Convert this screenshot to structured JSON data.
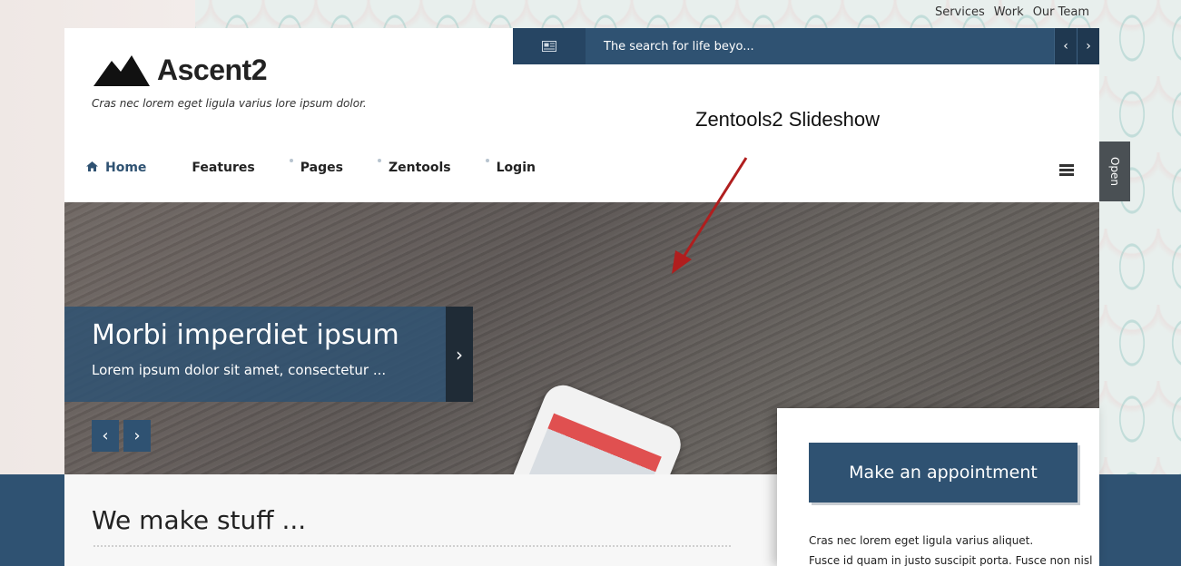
{
  "top_links": [
    "Services",
    "Work",
    "Our Team"
  ],
  "header": {
    "logo_text": "Ascent2",
    "tagline": "Cras nec lorem eget ligula varius lore ipsum dolor."
  },
  "ticker": {
    "icon": "newspaper-icon",
    "text": "The search for life beyo...",
    "prev": "‹",
    "next": "›"
  },
  "annotation": "Zentools2 Slideshow",
  "nav": {
    "items": [
      {
        "label": "Home",
        "icon": "home-icon"
      },
      {
        "label": "Features"
      },
      {
        "label": "Pages"
      },
      {
        "label": "Zentools"
      },
      {
        "label": "Login"
      }
    ]
  },
  "open_tab": "Open",
  "slide": {
    "title": "Morbi imperdiet ipsum",
    "text": "Lorem ipsum dolor sit amet, consectetur ...",
    "next_icon": "›",
    "prev_btn": "‹",
    "next_btn": "›"
  },
  "main": {
    "heading": "We make stuff ..."
  },
  "sidebar": {
    "button": "Make an appointment",
    "text1": "Cras nec lorem eget ligula varius aliquet.",
    "text2": "Fusce id quam in justo suscipit porta. Fusce non nisl"
  },
  "colors": {
    "brand": "#2f5272",
    "arrow": "#b01e1e"
  }
}
